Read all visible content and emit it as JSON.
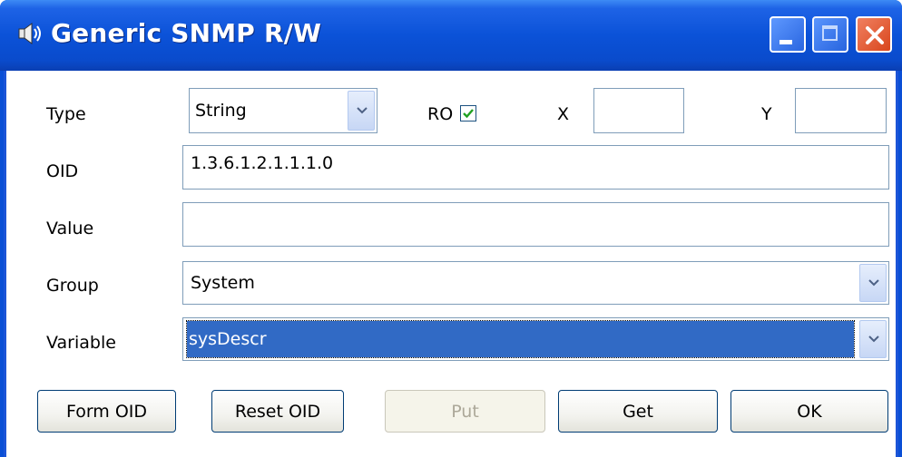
{
  "window": {
    "title": "Generic SNMP R/W"
  },
  "form": {
    "type_label": "Type",
    "type_value": "String",
    "ro_label": "RO",
    "ro_checked": true,
    "x_label": "X",
    "x_value": "",
    "y_label": "Y",
    "y_value": "",
    "oid_label": "OID",
    "oid_value": "1.3.6.1.2.1.1.1.0",
    "value_label": "Value",
    "value_value": "",
    "group_label": "Group",
    "group_value": "System",
    "variable_label": "Variable",
    "variable_value": "sysDescr"
  },
  "buttons": {
    "form_oid": "Form OID",
    "reset_oid": "Reset OID",
    "put": "Put",
    "get": "Get",
    "ok": "OK"
  }
}
